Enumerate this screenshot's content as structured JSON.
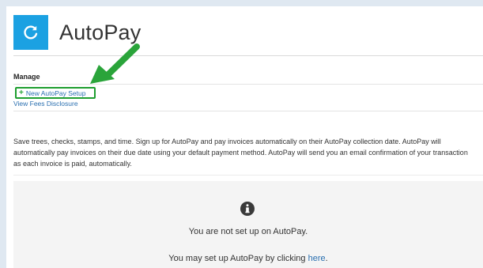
{
  "header": {
    "title": "AutoPay",
    "icon": "refresh-icon",
    "icon_color": "#1ba1e2"
  },
  "manage": {
    "label": "Manage",
    "new_setup_plus": "+",
    "new_setup_label": "New AutoPay Setup",
    "fees_label": "View Fees Disclosure",
    "highlight_color": "#1e9e2f"
  },
  "description": "Save trees, checks, stamps, and time. Sign up for AutoPay and pay invoices automatically on their AutoPay collection date. AutoPay will automatically pay invoices on their due date using your default payment method. AutoPay will send you an email confirmation of your transaction as each invoice is paid, automatically.",
  "empty_state": {
    "icon": "info-icon",
    "message": "You are not set up on AutoPay.",
    "help_prefix": "You may set up AutoPay by clicking ",
    "help_link": "here",
    "help_suffix": "."
  },
  "colors": {
    "link": "#2a6fb0",
    "arrow": "#2aa43a"
  }
}
